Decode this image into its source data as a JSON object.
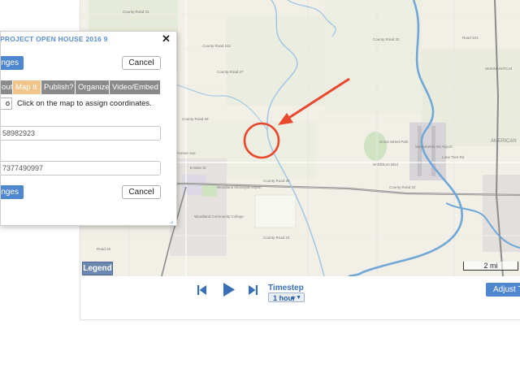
{
  "panel": {
    "title": "PROJECT OPEN HOUSE 2016 9",
    "save_top": "nges",
    "cancel_top": "Cancel",
    "tabs": [
      {
        "label": "out",
        "active": false
      },
      {
        "label": "Map It",
        "active": true
      },
      {
        "label": "Publish?",
        "active": false
      },
      {
        "label": "Organize",
        "active": false
      },
      {
        "label": "Video/Embed",
        "active": false
      }
    ],
    "coord_prefix": "o",
    "instruction": "Click on the map to assign coordinates.",
    "latitude": "58982923",
    "longitude": "7377490997",
    "save_bottom": "nges",
    "cancel_bottom": "Cancel"
  },
  "map": {
    "legend_label": "Legend",
    "scale_label": "2 mi",
    "marker_color": "#e8492e",
    "labels": [
      "County Road 31",
      "County Road 102",
      "County Road 32",
      "Road 101",
      "County Road 27",
      "County Road 29",
      "W Pioneer Ave",
      "E Main St",
      "County Road 25",
      "County Road 24",
      "Woodland Municipal Airport",
      "Cross Street Park",
      "Sacramento Intl Airport",
      "W Elkhorn Blvd",
      "Lone Tree Rd",
      "County Road 22",
      "AMERICAN",
      "SKINNEHATCHI",
      "Woodland Community College",
      "Road 16"
    ]
  },
  "controls": {
    "prev_icon": "skip-back-icon",
    "play_icon": "play-icon",
    "next_icon": "skip-forward-icon",
    "timestep_label": "Timestep",
    "timestep_value": "1 hour",
    "adjust_label": "Adjust T"
  }
}
